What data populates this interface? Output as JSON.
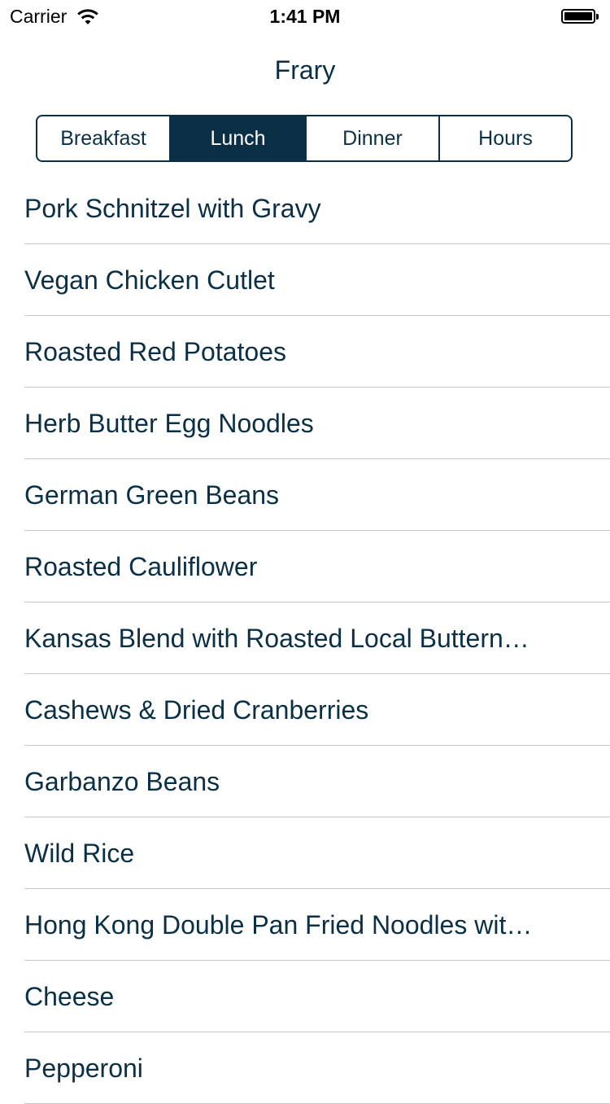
{
  "status_bar": {
    "carrier": "Carrier",
    "time": "1:41 PM",
    "wifi_icon": "wifi-icon",
    "battery_icon": "battery-full-icon"
  },
  "nav": {
    "title": "Frary"
  },
  "meal_tabs": {
    "selected": "Lunch",
    "items": [
      {
        "label": "Breakfast"
      },
      {
        "label": "Lunch"
      },
      {
        "label": "Dinner"
      },
      {
        "label": "Hours"
      }
    ]
  },
  "menu": {
    "items": [
      {
        "label": "Pork Schnitzel with Gravy"
      },
      {
        "label": "Vegan Chicken Cutlet"
      },
      {
        "label": "Roasted Red Potatoes"
      },
      {
        "label": "Herb Butter Egg Noodles"
      },
      {
        "label": "German Green Beans"
      },
      {
        "label": "Roasted Cauliflower"
      },
      {
        "label": "Kansas Blend with Roasted Local Buttern…"
      },
      {
        "label": "Cashews & Dried Cranberries"
      },
      {
        "label": "Garbanzo Beans"
      },
      {
        "label": "Wild Rice"
      },
      {
        "label": "Hong Kong Double Pan Fried Noodles wit…"
      },
      {
        "label": "Cheese"
      },
      {
        "label": "Pepperoni"
      }
    ]
  },
  "colors": {
    "accent": "#0b3046",
    "separator": "#c8c7cc",
    "background": "#ffffff"
  }
}
